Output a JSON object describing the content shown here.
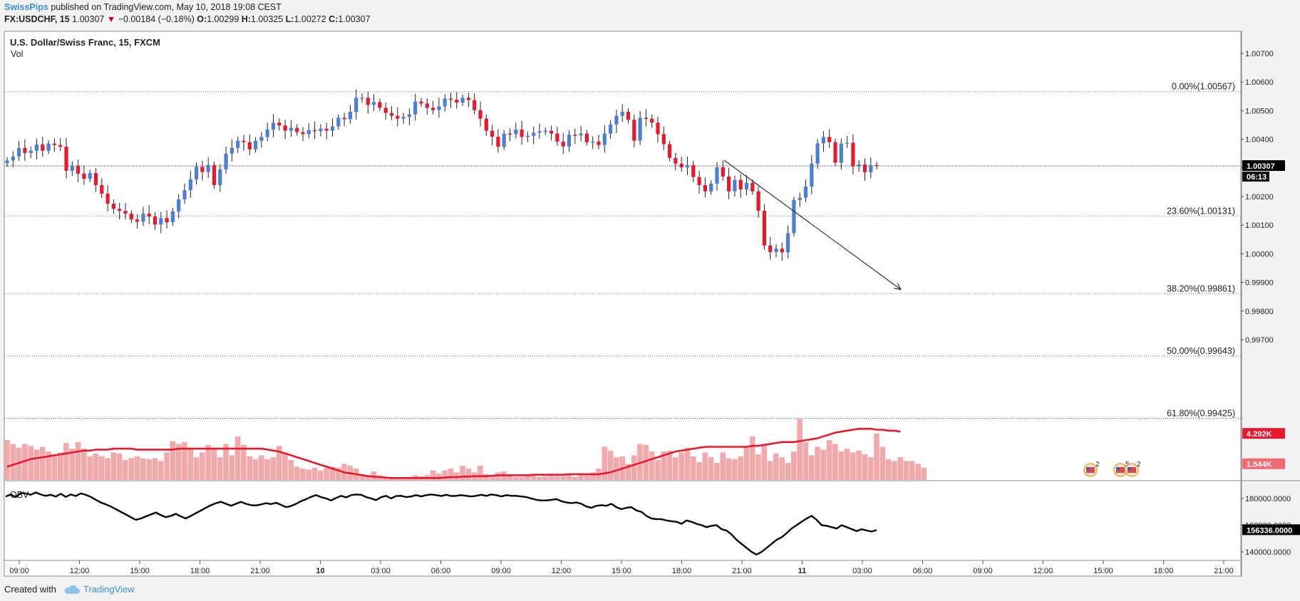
{
  "header": {
    "author": "SwissPips",
    "published": "published on TradingView.com, May 10, 2018 19:08 CEST",
    "symbol": "FX:USDCHF, 15",
    "last": "1.00307",
    "change": "−0.00184 (−0.18%)",
    "o_label": "O:",
    "o": "1.00299",
    "h_label": "H:",
    "h": "1.00325",
    "l_label": "L:",
    "l": "1.00272",
    "c_label": "C:",
    "c": "1.00307"
  },
  "panels": {
    "title": "U.S. Dollar/Swiss Franc, 15, FXCM",
    "vol_label": "Vol",
    "obv_label": "OBV"
  },
  "footer": {
    "created_with": "Created with",
    "brand": "TradingView"
  },
  "colors": {
    "up": "#4a7fd8",
    "down": "#e8192c",
    "wick": "#222222",
    "volume_bar": "#f2a9ab",
    "volume_ma": "#e8192c",
    "obv": "#000000",
    "badge_price": "#000000",
    "badge_volume": "#e8192c",
    "badge_volume_light": "#f26b73"
  },
  "chart_data": [
    {
      "type": "candlestick",
      "title": "U.S. Dollar/Swiss Franc, 15, FXCM",
      "ylim": [
        0.9935,
        1.0078
      ],
      "y_ticks": [
        "1.00700",
        "1.00600",
        "1.00500",
        "1.00400",
        "1.00300",
        "1.00200",
        "1.00100",
        "1.00000",
        "0.99900",
        "0.99800",
        "0.99700"
      ],
      "x_ticks": [
        "09:00",
        "12:00",
        "15:00",
        "18:00",
        "21:00",
        "10",
        "03:00",
        "06:00",
        "09:00",
        "12:00",
        "15:00",
        "18:00",
        "21:00",
        "11",
        "03:00",
        "06:00",
        "09:00",
        "12:00",
        "15:00",
        "18:00",
        "21:00"
      ],
      "current_price": {
        "value": 1.00307,
        "label": "1.00307",
        "countdown": "06:13"
      },
      "fibonacci": [
        {
          "value": 1.00567,
          "label": "0.00%(1.00567)"
        },
        {
          "value": 1.00131,
          "label": "23.60%(1.00131)"
        },
        {
          "value": 0.99861,
          "label": "38.20%(0.99861)"
        },
        {
          "value": 0.99643,
          "label": "50.00%(0.99643)"
        },
        {
          "value": 0.99425,
          "label": "61.80%(0.99425)"
        }
      ],
      "trend_arrow": {
        "from_value": 1.00327,
        "to_value": 0.99875
      },
      "closes": [
        1.00326,
        1.0034,
        1.0037,
        1.00352,
        1.0036,
        1.00382,
        1.0036,
        1.00385,
        1.0038,
        1.00374,
        1.0029,
        1.00308,
        1.0028,
        1.00262,
        1.00282,
        1.0024,
        1.0021,
        1.00175,
        1.00157,
        1.0015,
        1.0014,
        1.0012,
        1.00112,
        1.0014,
        1.0013,
        1.00102,
        1.00125,
        1.0011,
        1.00148,
        1.0019,
        1.00222,
        1.0026,
        1.00304,
        1.00286,
        1.0031,
        1.0024,
        1.00295,
        1.0035,
        1.0037,
        1.00395,
        1.0039,
        1.00365,
        1.00395,
        1.00408,
        1.00434,
        1.00458,
        1.00448,
        1.0043,
        1.0044,
        1.00425,
        1.00418,
        1.00432,
        1.00428,
        1.00437,
        1.0043,
        1.00445,
        1.00475,
        1.0047,
        1.00496,
        1.00545,
        1.00545,
        1.0052,
        1.0053,
        1.0051,
        1.00492,
        1.00482,
        1.00472,
        1.00478,
        1.00487,
        1.00532,
        1.00525,
        1.0051,
        1.00502,
        1.00515,
        1.00542,
        1.00538,
        1.00528,
        1.00545,
        1.00537,
        1.00502,
        1.00472,
        1.0043,
        1.00409,
        1.00374,
        1.0042,
        1.00418,
        1.00434,
        1.00408,
        1.00412,
        1.00423,
        1.00428,
        1.0043,
        1.0042,
        1.00392,
        1.00375,
        1.00416,
        1.00414,
        1.0042,
        1.0039,
        1.00392,
        1.0038,
        1.0042,
        1.00452,
        1.00482,
        1.00496,
        1.00468,
        1.00395,
        1.00475,
        1.00472,
        1.00458,
        1.00418,
        1.00383,
        1.00335,
        1.00315,
        1.00302,
        1.0031,
        1.00268,
        1.0024,
        1.00218,
        1.00245,
        1.00302,
        1.0027,
        1.00218,
        1.00258,
        1.00225,
        1.00248,
        1.00218,
        1.0015,
        1.00029,
        1.00006,
        1.00018,
        1.00005,
        1.00072,
        1.00188,
        1.00196,
        1.00235,
        1.00315,
        1.00386,
        1.00408,
        1.0039,
        1.00318,
        1.00385,
        1.00388,
        1.00305,
        1.00312,
        1.00285,
        1.0031,
        1.00307
      ],
      "bar_range": "candle bars, 15 minutes each, May 9 08:45 to May 10 19:00"
    },
    {
      "type": "bar",
      "name": "Vol",
      "ylim": [
        0,
        9
      ],
      "ma_label": "4.292K",
      "last_label": "1.544K",
      "values": [
        4.2,
        3.8,
        3.4,
        3.8,
        3.6,
        3.2,
        3.5,
        3.0,
        2.7,
        2.9,
        3.9,
        3.3,
        4.0,
        3.3,
        2.5,
        2.8,
        2.5,
        2.3,
        2.9,
        2.8,
        2.1,
        2.3,
        2.5,
        2.3,
        2.2,
        2.3,
        2.0,
        2.9,
        4.1,
        3.8,
        4.0,
        3.4,
        2.4,
        2.9,
        3.7,
        3.3,
        2.4,
        3.8,
        2.6,
        4.6,
        3.7,
        2.5,
        2.2,
        2.6,
        2.2,
        2.4,
        3.6,
        2.9,
        2.1,
        1.4,
        1.2,
        1.1,
        1.3,
        1.0,
        1.3,
        1.4,
        1.3,
        1.7,
        1.5,
        1.2,
        0.6,
        0.5,
        0.9,
        0.5,
        0.3,
        0.2,
        0.2,
        0.1,
        0.3,
        0.5,
        0.4,
        0.5,
        1.0,
        0.7,
        1.0,
        1.2,
        0.8,
        1.5,
        1.2,
        0.8,
        1.5,
        0.6,
        0.4,
        0.8,
        0.9,
        0.5,
        0.3,
        0.3,
        0.4,
        0.6,
        0.3,
        0.4,
        0.5,
        0.4,
        0.4,
        0.5,
        0.3,
        0.7,
        0.6,
        0.8,
        1.2,
        3.5,
        3.1,
        2.4,
        2.5,
        1.7,
        2.6,
        3.8,
        3.7,
        3.0,
        2.1,
        3.0,
        3.1,
        2.4,
        2.9,
        3.4,
        2.5,
        1.9,
        2.9,
        2.4,
        1.8,
        2.9,
        2.3,
        2.2,
        2.5,
        3.5,
        4.6,
        2.7,
        3.8,
        2.0,
        2.8,
        2.4,
        1.8,
        3.0,
        6.5,
        4.0,
        2.6,
        3.5,
        3.2,
        4.2,
        3.8,
        3.0,
        3.3,
        2.9,
        3.1,
        2.7,
        2.4,
        4.9,
        3.5,
        2.2,
        2.0,
        2.4,
        2.0,
        2.0,
        1.7,
        1.3
      ],
      "ma_values": [
        1.4,
        1.6,
        1.8,
        2.0,
        2.2,
        2.3,
        2.4,
        2.5,
        2.6,
        2.7,
        2.8,
        2.9,
        3.0,
        3.1,
        3.1,
        3.2,
        3.2,
        3.2,
        3.3,
        3.3,
        3.3,
        3.3,
        3.2,
        3.2,
        3.2,
        3.2,
        3.2,
        3.2,
        3.2,
        3.3,
        3.3,
        3.3,
        3.3,
        3.3,
        3.3,
        3.3,
        3.3,
        3.3,
        3.3,
        3.3,
        3.3,
        3.3,
        3.3,
        3.3,
        3.2,
        3.1,
        3.0,
        2.8,
        2.6,
        2.4,
        2.2,
        2.0,
        1.8,
        1.6,
        1.4,
        1.2,
        1.0,
        0.8,
        0.7,
        0.6,
        0.5,
        0.4,
        0.35,
        0.3,
        0.25,
        0.2,
        0.2,
        0.2,
        0.2,
        0.2,
        0.2,
        0.2,
        0.2,
        0.2,
        0.25,
        0.3,
        0.3,
        0.35,
        0.35,
        0.4,
        0.4,
        0.4,
        0.45,
        0.5,
        0.5,
        0.5,
        0.5,
        0.5,
        0.5,
        0.55,
        0.55,
        0.55,
        0.55,
        0.55,
        0.55,
        0.6,
        0.6,
        0.6,
        0.6,
        0.6,
        0.6,
        0.7,
        0.8,
        1.0,
        1.2,
        1.4,
        1.6,
        1.8,
        2.0,
        2.2,
        2.4,
        2.6,
        2.8,
        3.0,
        3.1,
        3.2,
        3.3,
        3.4,
        3.5,
        3.5,
        3.5,
        3.5,
        3.5,
        3.5,
        3.5,
        3.5,
        3.6,
        3.6,
        3.7,
        3.8,
        3.9,
        4.0,
        4.0,
        4.0,
        4.1,
        4.2,
        4.3,
        4.4,
        4.6,
        4.8,
        5.0,
        5.1,
        5.2,
        5.3,
        5.4,
        5.4,
        5.4,
        5.3,
        5.3,
        5.2,
        5.2,
        5.1
      ]
    },
    {
      "type": "line",
      "name": "OBV",
      "ylim": [
        130000,
        190000
      ],
      "y_ticks": [
        "180000.0000",
        "160000.0000",
        "140000.0000"
      ],
      "last_label": "156336.0000",
      "values": [
        181500,
        183000,
        181000,
        184000,
        183800,
        182800,
        184500,
        183000,
        182000,
        182800,
        181400,
        183500,
        181200,
        183000,
        181800,
        183800,
        182700,
        181200,
        179000,
        177000,
        175500,
        174000,
        172000,
        170000,
        168000,
        166000,
        164000,
        165000,
        166500,
        168000,
        169500,
        167500,
        166000,
        167000,
        168500,
        166500,
        165000,
        167000,
        169000,
        171000,
        173000,
        175000,
        176500,
        177500,
        176000,
        174500,
        176000,
        177500,
        176000,
        175000,
        174800,
        175500,
        176500,
        175800,
        176800,
        175200,
        173500,
        174300,
        176000,
        178000,
        179400,
        181200,
        182500,
        181000,
        180000,
        178500,
        180400,
        182000,
        180800,
        182500,
        183000,
        182800,
        181000,
        180000,
        178800,
        181000,
        182000,
        180000,
        181800,
        182000,
        181000,
        181500,
        182500,
        181500,
        182500,
        183000,
        182500,
        181800,
        182800,
        181800,
        182000,
        182500,
        182000,
        181500,
        182000,
        182800,
        182000,
        183000,
        182500,
        181500,
        182500,
        182000,
        182000,
        181500,
        181000,
        180000,
        179000,
        178500,
        178500,
        179000,
        179500,
        178000,
        177000,
        176500,
        177000,
        176000,
        174000,
        173000,
        174500,
        175000,
        174500,
        176000,
        173500,
        172000,
        173000,
        173500,
        171000,
        170000,
        167000,
        165000,
        164500,
        164500,
        163500,
        163000,
        162500,
        161000,
        163500,
        162500,
        161000,
        160000,
        158500,
        159500,
        160000,
        157000,
        156000,
        153000,
        149000,
        146000,
        143000,
        140000,
        138000,
        140000,
        143000,
        146000,
        149000,
        151000,
        154000,
        157500,
        160000,
        162500,
        165000,
        167000,
        164000,
        160000,
        159500,
        158500,
        157500,
        160000,
        158500,
        157000,
        155500,
        157000,
        156000,
        155200,
        156336
      ],
      "x_range": "OBV sampled at half-bar steps across the same time span"
    }
  ]
}
